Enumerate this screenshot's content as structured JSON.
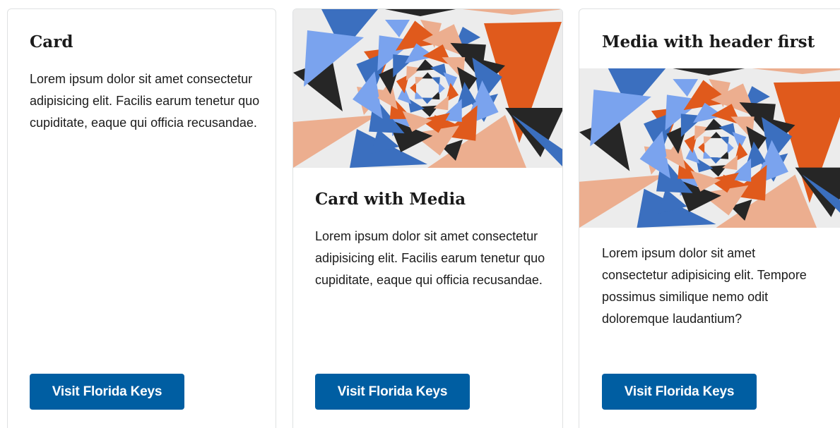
{
  "cards": [
    {
      "title": "Card",
      "body": "Lorem ipsum dolor sit amet consectetur adipisicing elit. Facilis earum tenetur quo cupiditate, eaque qui officia recusandae.",
      "button_label": "Visit Florida Keys"
    },
    {
      "title": "Card with Media",
      "body": "Lorem ipsum dolor sit amet consectetur adipisicing elit. Facilis earum tenetur quo cupiditate, eaque qui officia recusandae.",
      "button_label": "Visit Florida Keys"
    },
    {
      "title": "Media with header first",
      "body": "Lorem ipsum dolor sit amet consectetur adipisicing elit. Tempore possimus similique nemo odit doloremque laudantium?",
      "button_label": "Visit Florida Keys"
    }
  ],
  "colors": {
    "button": "#005ea2",
    "border": "#dfe1e2",
    "text": "#1b1b1b",
    "art_blue": "#3b6fbf",
    "art_light_blue": "#7aa3ee",
    "art_orange": "#e05a1c",
    "art_peach": "#ecae8f",
    "art_dark": "#262626",
    "art_bg": "#ececec"
  }
}
